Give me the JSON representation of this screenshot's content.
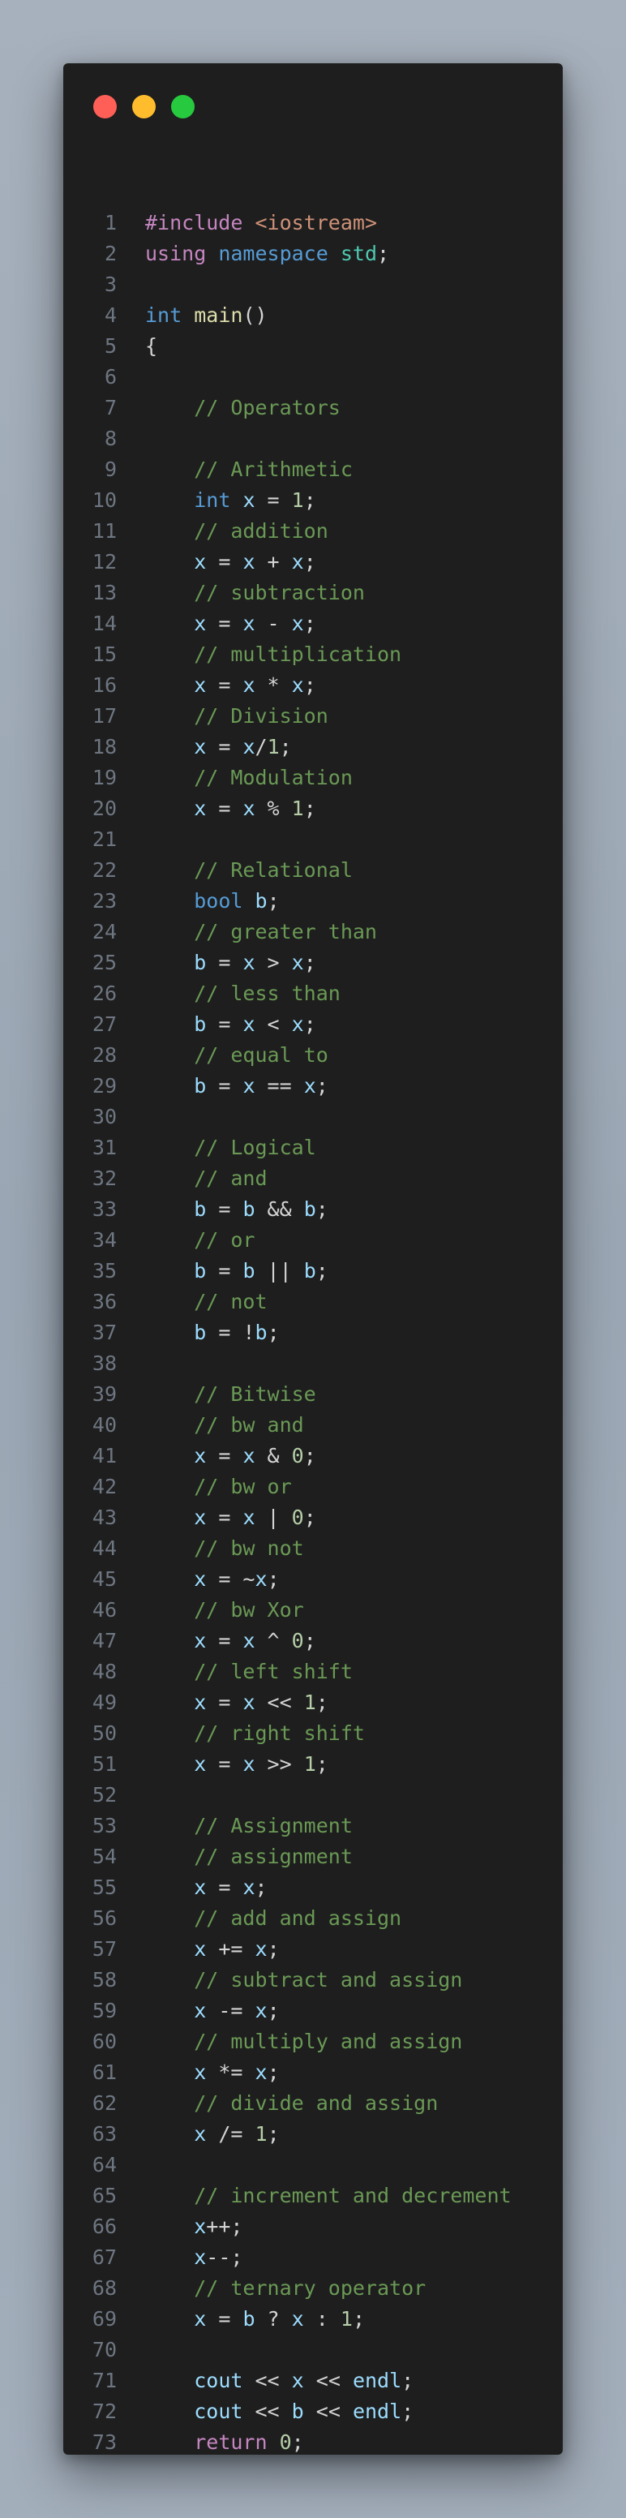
{
  "window": {
    "controls": [
      {
        "name": "close-button",
        "color": "#ff5f56"
      },
      {
        "name": "minimize-button",
        "color": "#ffbd2e"
      },
      {
        "name": "zoom-button",
        "color": "#27c93f"
      }
    ]
  },
  "code": {
    "language": "cpp",
    "lines": [
      [
        [
          "pp",
          "#include"
        ],
        [
          "sp",
          " "
        ],
        [
          "inc",
          "<iostream>"
        ]
      ],
      [
        [
          "ctl",
          "using"
        ],
        [
          "sp",
          " "
        ],
        [
          "kw",
          "namespace"
        ],
        [
          "sp",
          " "
        ],
        [
          "ns",
          "std"
        ],
        [
          "pu",
          ";"
        ]
      ],
      [],
      [
        [
          "kw",
          "int"
        ],
        [
          "sp",
          " "
        ],
        [
          "fn",
          "main"
        ],
        [
          "pu",
          "()"
        ]
      ],
      [
        [
          "pu",
          "{"
        ]
      ],
      [],
      [
        [
          "sp",
          "    "
        ],
        [
          "cm",
          "// Operators"
        ]
      ],
      [],
      [
        [
          "sp",
          "    "
        ],
        [
          "cm",
          "// Arithmetic"
        ]
      ],
      [
        [
          "sp",
          "    "
        ],
        [
          "kw",
          "int"
        ],
        [
          "sp",
          " "
        ],
        [
          "var",
          "x"
        ],
        [
          "op",
          " = "
        ],
        [
          "num",
          "1"
        ],
        [
          "pu",
          ";"
        ]
      ],
      [
        [
          "sp",
          "    "
        ],
        [
          "cm",
          "// addition"
        ]
      ],
      [
        [
          "sp",
          "    "
        ],
        [
          "var",
          "x"
        ],
        [
          "op",
          " = "
        ],
        [
          "var",
          "x"
        ],
        [
          "op",
          " + "
        ],
        [
          "var",
          "x"
        ],
        [
          "pu",
          ";"
        ]
      ],
      [
        [
          "sp",
          "    "
        ],
        [
          "cm",
          "// subtraction"
        ]
      ],
      [
        [
          "sp",
          "    "
        ],
        [
          "var",
          "x"
        ],
        [
          "op",
          " = "
        ],
        [
          "var",
          "x"
        ],
        [
          "op",
          " - "
        ],
        [
          "var",
          "x"
        ],
        [
          "pu",
          ";"
        ]
      ],
      [
        [
          "sp",
          "    "
        ],
        [
          "cm",
          "// multiplication"
        ]
      ],
      [
        [
          "sp",
          "    "
        ],
        [
          "var",
          "x"
        ],
        [
          "op",
          " = "
        ],
        [
          "var",
          "x"
        ],
        [
          "op",
          " * "
        ],
        [
          "var",
          "x"
        ],
        [
          "pu",
          ";"
        ]
      ],
      [
        [
          "sp",
          "    "
        ],
        [
          "cm",
          "// Division"
        ]
      ],
      [
        [
          "sp",
          "    "
        ],
        [
          "var",
          "x"
        ],
        [
          "op",
          " = "
        ],
        [
          "var",
          "x"
        ],
        [
          "op",
          "/"
        ],
        [
          "num",
          "1"
        ],
        [
          "pu",
          ";"
        ]
      ],
      [
        [
          "sp",
          "    "
        ],
        [
          "cm",
          "// Modulation"
        ]
      ],
      [
        [
          "sp",
          "    "
        ],
        [
          "var",
          "x"
        ],
        [
          "op",
          " = "
        ],
        [
          "var",
          "x"
        ],
        [
          "op",
          " % "
        ],
        [
          "num",
          "1"
        ],
        [
          "pu",
          ";"
        ]
      ],
      [],
      [
        [
          "sp",
          "    "
        ],
        [
          "cm",
          "// Relational"
        ]
      ],
      [
        [
          "sp",
          "    "
        ],
        [
          "kw",
          "bool"
        ],
        [
          "sp",
          " "
        ],
        [
          "var",
          "b"
        ],
        [
          "pu",
          ";"
        ]
      ],
      [
        [
          "sp",
          "    "
        ],
        [
          "cm",
          "// greater than"
        ]
      ],
      [
        [
          "sp",
          "    "
        ],
        [
          "var",
          "b"
        ],
        [
          "op",
          " = "
        ],
        [
          "var",
          "x"
        ],
        [
          "op",
          " > "
        ],
        [
          "var",
          "x"
        ],
        [
          "pu",
          ";"
        ]
      ],
      [
        [
          "sp",
          "    "
        ],
        [
          "cm",
          "// less than"
        ]
      ],
      [
        [
          "sp",
          "    "
        ],
        [
          "var",
          "b"
        ],
        [
          "op",
          " = "
        ],
        [
          "var",
          "x"
        ],
        [
          "op",
          " < "
        ],
        [
          "var",
          "x"
        ],
        [
          "pu",
          ";"
        ]
      ],
      [
        [
          "sp",
          "    "
        ],
        [
          "cm",
          "// equal to"
        ]
      ],
      [
        [
          "sp",
          "    "
        ],
        [
          "var",
          "b"
        ],
        [
          "op",
          " = "
        ],
        [
          "var",
          "x"
        ],
        [
          "op",
          " == "
        ],
        [
          "var",
          "x"
        ],
        [
          "pu",
          ";"
        ]
      ],
      [],
      [
        [
          "sp",
          "    "
        ],
        [
          "cm",
          "// Logical"
        ]
      ],
      [
        [
          "sp",
          "    "
        ],
        [
          "cm",
          "// and"
        ]
      ],
      [
        [
          "sp",
          "    "
        ],
        [
          "var",
          "b"
        ],
        [
          "op",
          " = "
        ],
        [
          "var",
          "b"
        ],
        [
          "op",
          " && "
        ],
        [
          "var",
          "b"
        ],
        [
          "pu",
          ";"
        ]
      ],
      [
        [
          "sp",
          "    "
        ],
        [
          "cm",
          "// or"
        ]
      ],
      [
        [
          "sp",
          "    "
        ],
        [
          "var",
          "b"
        ],
        [
          "op",
          " = "
        ],
        [
          "var",
          "b"
        ],
        [
          "op",
          " || "
        ],
        [
          "var",
          "b"
        ],
        [
          "pu",
          ";"
        ]
      ],
      [
        [
          "sp",
          "    "
        ],
        [
          "cm",
          "// not"
        ]
      ],
      [
        [
          "sp",
          "    "
        ],
        [
          "var",
          "b"
        ],
        [
          "op",
          " = !"
        ],
        [
          "var",
          "b"
        ],
        [
          "pu",
          ";"
        ]
      ],
      [],
      [
        [
          "sp",
          "    "
        ],
        [
          "cm",
          "// Bitwise"
        ]
      ],
      [
        [
          "sp",
          "    "
        ],
        [
          "cm",
          "// bw and"
        ]
      ],
      [
        [
          "sp",
          "    "
        ],
        [
          "var",
          "x"
        ],
        [
          "op",
          " = "
        ],
        [
          "var",
          "x"
        ],
        [
          "op",
          " & "
        ],
        [
          "num",
          "0"
        ],
        [
          "pu",
          ";"
        ]
      ],
      [
        [
          "sp",
          "    "
        ],
        [
          "cm",
          "// bw or"
        ]
      ],
      [
        [
          "sp",
          "    "
        ],
        [
          "var",
          "x"
        ],
        [
          "op",
          " = "
        ],
        [
          "var",
          "x"
        ],
        [
          "op",
          " | "
        ],
        [
          "num",
          "0"
        ],
        [
          "pu",
          ";"
        ]
      ],
      [
        [
          "sp",
          "    "
        ],
        [
          "cm",
          "// bw not"
        ]
      ],
      [
        [
          "sp",
          "    "
        ],
        [
          "var",
          "x"
        ],
        [
          "op",
          " = ~"
        ],
        [
          "var",
          "x"
        ],
        [
          "pu",
          ";"
        ]
      ],
      [
        [
          "sp",
          "    "
        ],
        [
          "cm",
          "// bw Xor"
        ]
      ],
      [
        [
          "sp",
          "    "
        ],
        [
          "var",
          "x"
        ],
        [
          "op",
          " = "
        ],
        [
          "var",
          "x"
        ],
        [
          "op",
          " ^ "
        ],
        [
          "num",
          "0"
        ],
        [
          "pu",
          ";"
        ]
      ],
      [
        [
          "sp",
          "    "
        ],
        [
          "cm",
          "// left shift"
        ]
      ],
      [
        [
          "sp",
          "    "
        ],
        [
          "var",
          "x"
        ],
        [
          "op",
          " = "
        ],
        [
          "var",
          "x"
        ],
        [
          "op",
          " << "
        ],
        [
          "num",
          "1"
        ],
        [
          "pu",
          ";"
        ]
      ],
      [
        [
          "sp",
          "    "
        ],
        [
          "cm",
          "// right shift"
        ]
      ],
      [
        [
          "sp",
          "    "
        ],
        [
          "var",
          "x"
        ],
        [
          "op",
          " = "
        ],
        [
          "var",
          "x"
        ],
        [
          "op",
          " >> "
        ],
        [
          "num",
          "1"
        ],
        [
          "pu",
          ";"
        ]
      ],
      [],
      [
        [
          "sp",
          "    "
        ],
        [
          "cm",
          "// Assignment"
        ]
      ],
      [
        [
          "sp",
          "    "
        ],
        [
          "cm",
          "// assignment"
        ]
      ],
      [
        [
          "sp",
          "    "
        ],
        [
          "var",
          "x"
        ],
        [
          "op",
          " = "
        ],
        [
          "var",
          "x"
        ],
        [
          "pu",
          ";"
        ]
      ],
      [
        [
          "sp",
          "    "
        ],
        [
          "cm",
          "// add and assign"
        ]
      ],
      [
        [
          "sp",
          "    "
        ],
        [
          "var",
          "x"
        ],
        [
          "op",
          " += "
        ],
        [
          "var",
          "x"
        ],
        [
          "pu",
          ";"
        ]
      ],
      [
        [
          "sp",
          "    "
        ],
        [
          "cm",
          "// subtract and assign"
        ]
      ],
      [
        [
          "sp",
          "    "
        ],
        [
          "var",
          "x"
        ],
        [
          "op",
          " -= "
        ],
        [
          "var",
          "x"
        ],
        [
          "pu",
          ";"
        ]
      ],
      [
        [
          "sp",
          "    "
        ],
        [
          "cm",
          "// multiply and assign"
        ]
      ],
      [
        [
          "sp",
          "    "
        ],
        [
          "var",
          "x"
        ],
        [
          "op",
          " *= "
        ],
        [
          "var",
          "x"
        ],
        [
          "pu",
          ";"
        ]
      ],
      [
        [
          "sp",
          "    "
        ],
        [
          "cm",
          "// divide and assign"
        ]
      ],
      [
        [
          "sp",
          "    "
        ],
        [
          "var",
          "x"
        ],
        [
          "op",
          " /= "
        ],
        [
          "num",
          "1"
        ],
        [
          "pu",
          ";"
        ]
      ],
      [],
      [
        [
          "sp",
          "    "
        ],
        [
          "cm",
          "// increment and decrement"
        ]
      ],
      [
        [
          "sp",
          "    "
        ],
        [
          "var",
          "x"
        ],
        [
          "op",
          "++"
        ],
        [
          "pu",
          ";"
        ]
      ],
      [
        [
          "sp",
          "    "
        ],
        [
          "var",
          "x"
        ],
        [
          "op",
          "--"
        ],
        [
          "pu",
          ";"
        ]
      ],
      [
        [
          "sp",
          "    "
        ],
        [
          "cm",
          "// ternary operator"
        ]
      ],
      [
        [
          "sp",
          "    "
        ],
        [
          "var",
          "x"
        ],
        [
          "op",
          " = "
        ],
        [
          "var",
          "b"
        ],
        [
          "op",
          " ? "
        ],
        [
          "var",
          "x"
        ],
        [
          "op",
          " : "
        ],
        [
          "num",
          "1"
        ],
        [
          "pu",
          ";"
        ]
      ],
      [],
      [
        [
          "sp",
          "    "
        ],
        [
          "var",
          "cout"
        ],
        [
          "op",
          " << "
        ],
        [
          "var",
          "x"
        ],
        [
          "op",
          " << "
        ],
        [
          "var",
          "endl"
        ],
        [
          "pu",
          ";"
        ]
      ],
      [
        [
          "sp",
          "    "
        ],
        [
          "var",
          "cout"
        ],
        [
          "op",
          " << "
        ],
        [
          "var",
          "b"
        ],
        [
          "op",
          " << "
        ],
        [
          "var",
          "endl"
        ],
        [
          "pu",
          ";"
        ]
      ],
      [
        [
          "sp",
          "    "
        ],
        [
          "ctl",
          "return"
        ],
        [
          "sp",
          " "
        ],
        [
          "num",
          "0"
        ],
        [
          "pu",
          ";"
        ]
      ],
      [
        [
          "pu",
          "}"
        ]
      ]
    ]
  }
}
